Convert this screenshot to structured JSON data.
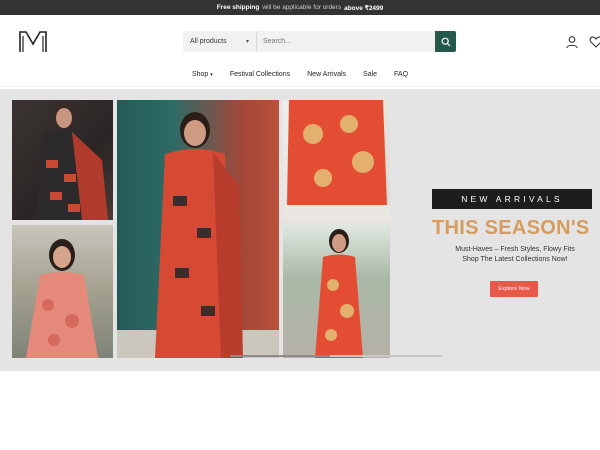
{
  "announcement": {
    "lead": "Free shipping",
    "middle": "will be applicable for orders",
    "tail": "above ₹2499"
  },
  "header": {
    "logo_alt": "M",
    "search": {
      "category": "All products",
      "placeholder": "Search..."
    }
  },
  "nav": {
    "items": [
      "Shop",
      "Festival Collections",
      "New Arrivals",
      "Sale",
      "FAQ"
    ]
  },
  "hero": {
    "badge": "NEW ARRIVALS",
    "headline": "THIS SEASON'S",
    "subline_1": "Must-Haves – Fresh Styles, Flowy Fits",
    "subline_2": "Shop The Latest Collections Now!",
    "cta": "Explore Now"
  },
  "colors": {
    "announcement_bg": "#333333",
    "search_button": "#24584a",
    "headline": "#d69b5e",
    "cta_bg": "#e8594a",
    "hero_bg": "#e4e4e4"
  },
  "icons": [
    "search-icon",
    "user-icon",
    "heart-icon",
    "chevron-down-icon"
  ]
}
